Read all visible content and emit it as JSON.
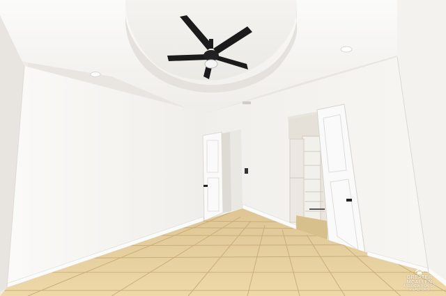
{
  "scene": {
    "description_tags": [
      "empty-bedroom",
      "ceiling-fan",
      "tray-ceiling",
      "tile-floor",
      "walk-in-closet",
      "open-doors"
    ],
    "colors": {
      "wall": "#f2f0ec",
      "wall_shadow": "#e4e1dc",
      "ceiling": "#f6f5f2",
      "floor": "#e6cf9e",
      "floor_grout": "#cbb27e",
      "baseboard": "#fbfbf9",
      "fan": "#1b1b1b",
      "door": "#fafafa",
      "closet_shelf": "#f1eee9"
    }
  },
  "watermark": {
    "line1": "GREATER MCALLEN",
    "line2": "ASSOCIATION OF REALTORS"
  }
}
